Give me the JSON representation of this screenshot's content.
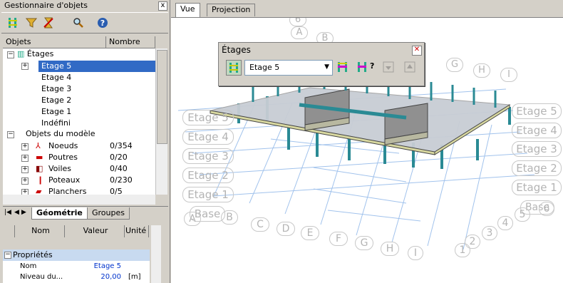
{
  "panel": {
    "title": "Gestionnaire d'objets",
    "columns": [
      "Objets",
      "Nombre d'..."
    ],
    "tree": {
      "root_etages": "Étages",
      "etages": [
        "Etage 5",
        "Etage 4",
        "Etage 3",
        "Etage 2",
        "Etage 1",
        "Indéfini"
      ],
      "root_objects": "Objets du modèle",
      "objects": [
        {
          "label": "Noeuds",
          "count": "0/354"
        },
        {
          "label": "Poutres",
          "count": "0/20"
        },
        {
          "label": "Voiles",
          "count": "0/40"
        },
        {
          "label": "Poteaux",
          "count": "0/230"
        },
        {
          "label": "Planchers",
          "count": "0/5"
        }
      ]
    },
    "tabs": [
      "Géométrie",
      "Groupes"
    ],
    "props": {
      "cols": [
        "Nom",
        "Valeur",
        "Unité"
      ],
      "section": "Propriétés",
      "rows": [
        {
          "name": "Nom",
          "value": "Etage 5",
          "unit": ""
        },
        {
          "name": "Niveau du...",
          "value": "20,00",
          "unit": "[m]"
        }
      ]
    }
  },
  "view": {
    "tabs": [
      "Vue",
      "Projection"
    ],
    "floatbar": {
      "title": "Étages",
      "selected": "Etage 5"
    },
    "level_labels_left": [
      "Etage 5",
      "Etage 4",
      "Etage 3",
      "Etage 2",
      "Etage 1",
      "Base"
    ],
    "level_labels_right": [
      "Etage 5",
      "Etage 4",
      "Etage 3",
      "Etage 2",
      "Etage 1",
      "Base"
    ],
    "grid_letters": [
      "A",
      "B",
      "C",
      "D",
      "E",
      "F",
      "G",
      "H",
      "I"
    ],
    "grid_numbers": [
      "1",
      "2",
      "3",
      "4",
      "5",
      "6"
    ],
    "top_letters": [
      "6",
      "A",
      "B",
      "G",
      "H",
      "I"
    ]
  }
}
